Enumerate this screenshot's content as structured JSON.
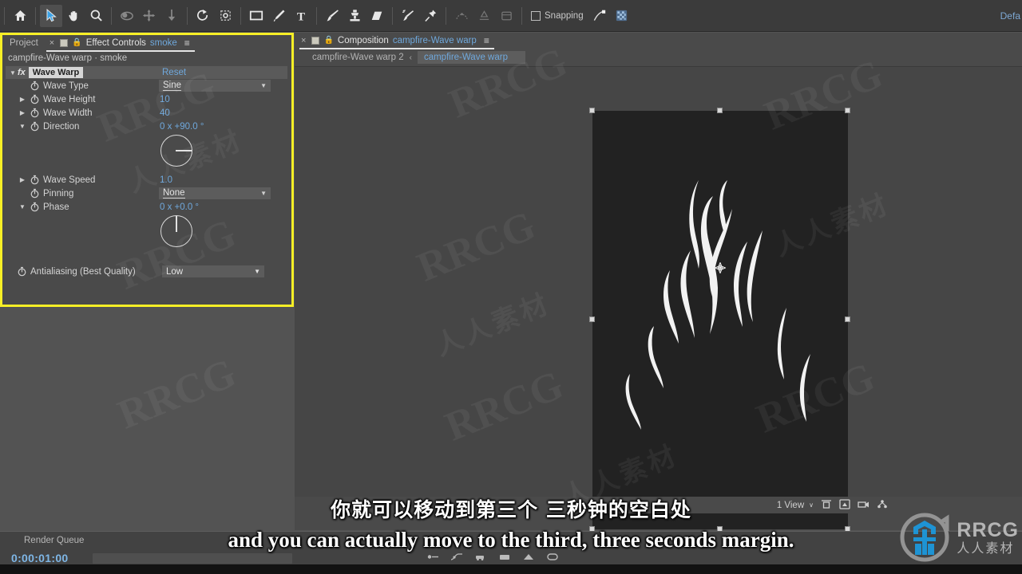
{
  "app": {
    "workspace_label": "Defa"
  },
  "toolbar": {
    "tools": [
      {
        "name": "home-icon",
        "label": "Home"
      },
      {
        "name": "selection-tool-icon",
        "label": "Selection Tool"
      },
      {
        "name": "hand-tool-icon",
        "label": "Hand Tool"
      },
      {
        "name": "zoom-tool-icon",
        "label": "Zoom Tool"
      },
      {
        "name": "orbit-camera-tool-icon",
        "label": "Orbit Camera Tool"
      },
      {
        "name": "pan-camera-tool-icon",
        "label": "Pan Under Cursor Tool"
      },
      {
        "name": "dolly-camera-tool-icon",
        "label": "Dolly Towards Cursor Tool"
      },
      {
        "name": "rotation-tool-icon",
        "label": "Rotation Tool"
      },
      {
        "name": "anchor-point-tool-icon",
        "label": "Pan Behind Tool"
      },
      {
        "name": "shape-tool-icon",
        "label": "Rectangle Tool"
      },
      {
        "name": "pen-tool-icon",
        "label": "Pen Tool"
      },
      {
        "name": "type-tool-icon",
        "label": "Type Tool"
      },
      {
        "name": "brush-tool-icon",
        "label": "Brush Tool"
      },
      {
        "name": "clone-stamp-tool-icon",
        "label": "Clone Stamp Tool"
      },
      {
        "name": "eraser-tool-icon",
        "label": "Eraser Tool"
      },
      {
        "name": "roto-brush-tool-icon",
        "label": "Roto Brush Tool"
      },
      {
        "name": "puppet-pin-tool-icon",
        "label": "Puppet Pin Tool"
      }
    ],
    "snapping_label": "Snapping"
  },
  "effect_controls": {
    "tabs": {
      "project_label": "Project",
      "close_label": "×",
      "title": "Effect Controls",
      "subject": "smoke",
      "menu_glyph": "≡"
    },
    "breadcrumb": "campfire-Wave warp · smoke",
    "effect": {
      "fx_label": "fx",
      "name": "Wave Warp",
      "reset_label": "Reset"
    },
    "properties": [
      {
        "name": "Wave Type",
        "value": "Sine",
        "kind": "dropdown",
        "expandable": false
      },
      {
        "name": "Wave Height",
        "value": "10",
        "kind": "number",
        "expandable": true
      },
      {
        "name": "Wave Width",
        "value": "40",
        "kind": "number",
        "expandable": true
      },
      {
        "name": "Direction",
        "value": "0 x +90.0 °",
        "kind": "angle",
        "expandable": true,
        "expanded": true,
        "angle_deg": 90
      },
      {
        "name": "Wave Speed",
        "value": "1.0",
        "kind": "number",
        "expandable": true
      },
      {
        "name": "Pinning",
        "value": "None",
        "kind": "dropdown",
        "expandable": false
      },
      {
        "name": "Phase",
        "value": "0 x +0.0 °",
        "kind": "angle",
        "expandable": true,
        "expanded": true,
        "angle_deg": 0
      },
      {
        "name": "Antialiasing (Best Quality)",
        "value": "Low",
        "kind": "dropdown",
        "expandable": false
      }
    ]
  },
  "composition": {
    "tabs": {
      "close_label": "×",
      "title": "Composition",
      "subject": "campfire-Wave warp",
      "menu_glyph": "≡"
    },
    "breadcrumb": {
      "previous": "campfire-Wave warp 2",
      "separator": "‹",
      "current": "campfire-Wave warp"
    },
    "bottom_bar": {
      "view_count": "1 View",
      "view_arrow": "∨"
    }
  },
  "timeline": {
    "render_queue_label": "Render Queue",
    "timecode": "0:00:01:00"
  },
  "subtitles": {
    "chinese": "你就可以移动到第三个 三秒钟的空白处",
    "english": "and you can actually move to the third, three seconds margin."
  },
  "watermarks": {
    "latin": "RRCG",
    "chinese": "人人素材"
  },
  "logo": {
    "latin": "RRCG",
    "chinese": "人人素材"
  },
  "colors": {
    "accent_blue": "#6fa8dc",
    "highlight_yellow": "#f7ef26",
    "panel_bg": "#4a4a4a",
    "app_bg": "#535353",
    "canvas_bg": "#222222"
  }
}
